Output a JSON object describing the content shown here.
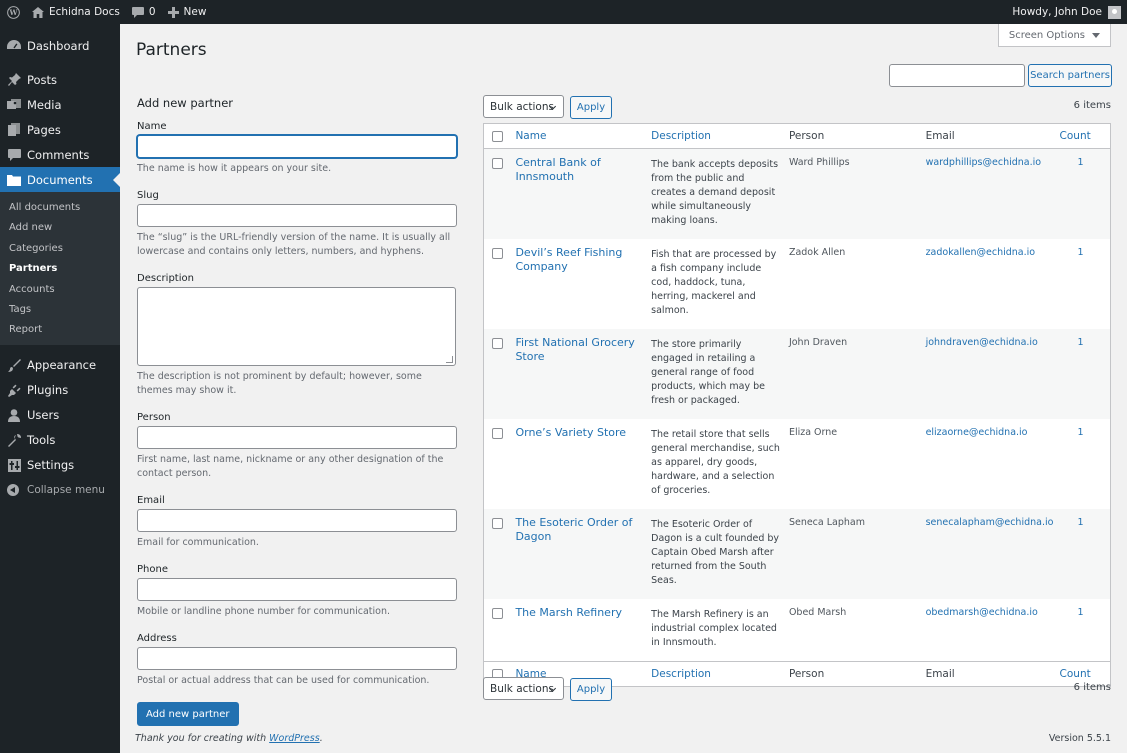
{
  "admin_bar": {
    "site_name": "Echidna Docs",
    "comments_count": "0",
    "new_label": "New",
    "greeting": "Howdy, John Doe"
  },
  "sidebar": {
    "top": [
      {
        "label": "Dashboard",
        "icon": "dashboard-icon"
      }
    ],
    "items": [
      {
        "label": "Posts",
        "icon": "pin-icon"
      },
      {
        "label": "Media",
        "icon": "media-icon"
      },
      {
        "label": "Pages",
        "icon": "pages-icon"
      },
      {
        "label": "Comments",
        "icon": "comment-icon"
      },
      {
        "label": "Documents",
        "icon": "folder-icon"
      }
    ],
    "submenu": [
      "All documents",
      "Add new",
      "Categories",
      "Partners",
      "Accounts",
      "Tags",
      "Report"
    ],
    "lower": [
      {
        "label": "Appearance",
        "icon": "brush-icon"
      },
      {
        "label": "Plugins",
        "icon": "plug-icon"
      },
      {
        "label": "Users",
        "icon": "user-icon"
      },
      {
        "label": "Tools",
        "icon": "wrench-icon"
      },
      {
        "label": "Settings",
        "icon": "settings-icon"
      }
    ],
    "collapse": "Collapse menu",
    "colors": {
      "background": "#1d2327",
      "current": "#2271b1",
      "submenu": "#2c3338"
    }
  },
  "page": {
    "title": "Partners",
    "screen_options": "Screen Options",
    "search_value": "",
    "search_button": "Search partners"
  },
  "form": {
    "heading": "Add new partner",
    "fields": {
      "name": {
        "label": "Name",
        "value": "",
        "hint": "The name is how it appears on your site."
      },
      "slug": {
        "label": "Slug",
        "value": "",
        "hint": "The “slug” is the URL-friendly version of the name. It is usually all lowercase and contains only letters, numbers, and hyphens."
      },
      "description": {
        "label": "Description",
        "value": "",
        "hint": "The description is not prominent by default; however, some themes may show it."
      },
      "person": {
        "label": "Person",
        "value": "",
        "hint": "First name, last name, nickname or any other designation of the contact person."
      },
      "email": {
        "label": "Email",
        "value": "",
        "hint": "Email for communication."
      },
      "phone": {
        "label": "Phone",
        "value": "",
        "hint": "Mobile or landline phone number for communication."
      },
      "address": {
        "label": "Address",
        "value": "",
        "hint": "Postal or actual address that can be used for communication."
      }
    },
    "submit": "Add new partner"
  },
  "table": {
    "bulk_actions": "Bulk actions",
    "apply": "Apply",
    "items_count": "6 items",
    "columns": {
      "name": "Name",
      "description": "Description",
      "person": "Person",
      "email": "Email",
      "count": "Count"
    },
    "rows": [
      {
        "name": "Central Bank of Innsmouth",
        "description": "The bank accepts deposits from the public and creates a demand deposit while simultaneously making loans.",
        "person": "Ward Phillips",
        "email": "wardphillips@echidna.io",
        "count": "1"
      },
      {
        "name": "Devil’s Reef Fishing Company",
        "description": "Fish that are processed by a fish company include cod, haddock, tuna, herring, mackerel and salmon.",
        "person": "Zadok Allen",
        "email": "zadokallen@echidna.io",
        "count": "1"
      },
      {
        "name": "First National Grocery Store",
        "description": "The store primarily engaged in retailing a general range of food products, which may be fresh or packaged.",
        "person": "John Draven",
        "email": "johndraven@echidna.io",
        "count": "1"
      },
      {
        "name": "Orne’s Variety Store",
        "description": "The retail store that sells general merchandise, such as apparel, dry goods, hardware, and a selection of groceries.",
        "person": "Eliza Orne",
        "email": "elizaorne@echidna.io",
        "count": "1"
      },
      {
        "name": "The Esoteric Order of Dagon",
        "description": "The Esoteric Order of Dagon is a cult founded by Captain Obed Marsh after returned from the South Seas.",
        "person": "Seneca Lapham",
        "email": "senecalapham@echidna.io",
        "count": "1"
      },
      {
        "name": "The Marsh Refinery",
        "description": "The Marsh Refinery is an industrial complex located in Innsmouth.",
        "person": "Obed Marsh",
        "email": "obedmarsh@echidna.io",
        "count": "1"
      }
    ]
  },
  "footer": {
    "thanks_prefix": "Thank you for creating with ",
    "thanks_link": "WordPress",
    "thanks_suffix": ".",
    "version": "Version 5.5.1"
  }
}
